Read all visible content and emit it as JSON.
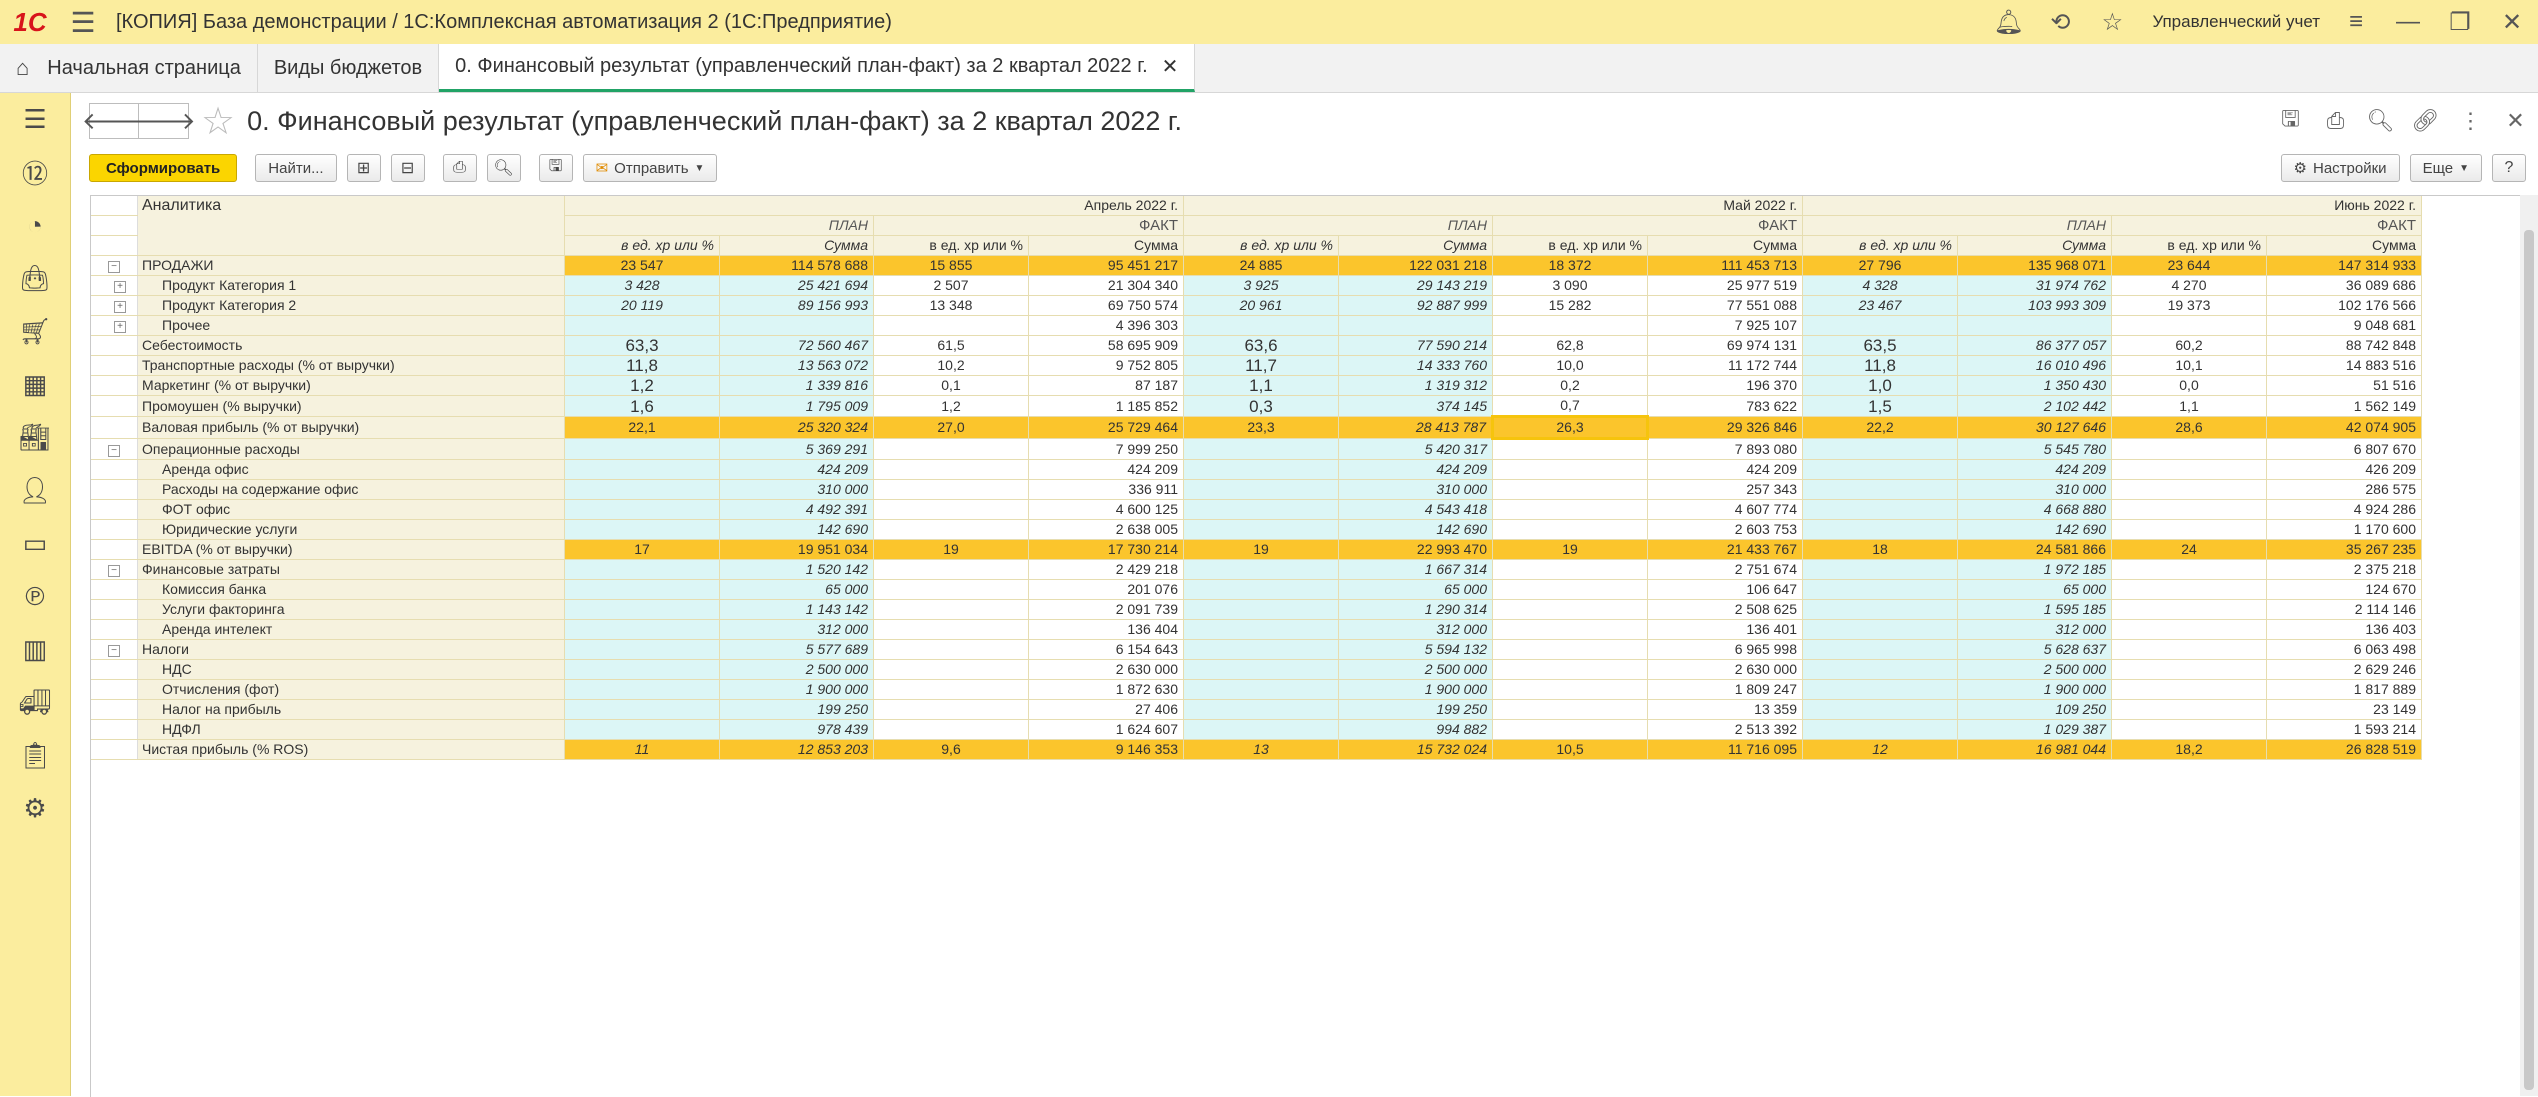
{
  "app": {
    "logo": "1С",
    "title": "[КОПИЯ] База демонстрации / 1С:Комплексная автоматизация 2  (1С:Предприятие)",
    "user": "Управленческий учет"
  },
  "tabs": [
    {
      "label": "Начальная страница"
    },
    {
      "label": "Виды  бюджетов"
    },
    {
      "label": "0. Финансовый результат (управленческий план-факт)  за 2 квартал 2022 г."
    }
  ],
  "form": {
    "title": "0. Финансовый результат (управленческий план-факт)  за 2 квартал 2022 г."
  },
  "toolbar": {
    "generate": "Сформировать",
    "find": "Найти...",
    "send": "Отправить",
    "settings": "Настройки",
    "more": "Еще",
    "help": "?"
  },
  "report": {
    "header_label": "Аналитика",
    "months": [
      "Апрель 2022 г.",
      "Май 2022 г.",
      "Июнь 2022 г."
    ],
    "plan": "ПЛАН",
    "fact": "ФАКТ",
    "col_unit": "в ед. хр или %",
    "col_sum": "Сумма",
    "rows": [
      {
        "label": "ПРОДАЖИ",
        "type": "big",
        "tree": "minus",
        "values": [
          "23 547",
          "114 578 688",
          "15 855",
          "95 451 217",
          "24 885",
          "122 031 218",
          "18 372",
          "111 453 713",
          "27 796",
          "135 968 071",
          "23 644",
          "147 314 933"
        ]
      },
      {
        "label": "Продукт Категория 1",
        "type": "sub",
        "tree": "plus",
        "values": [
          "3 428",
          "25 421 694",
          "2 507",
          "21 304 340",
          "3 925",
          "29 143 219",
          "3 090",
          "25 977 519",
          "4 328",
          "31 974 762",
          "4 270",
          "36 089 686"
        ]
      },
      {
        "label": "Продукт Категория 2",
        "type": "sub",
        "tree": "plus",
        "values": [
          "20 119",
          "89 156 993",
          "13 348",
          "69 750 574",
          "20 961",
          "92 887 999",
          "15 282",
          "77 551 088",
          "23 467",
          "103 993 309",
          "19 373",
          "102 176 566"
        ]
      },
      {
        "label": "Прочее",
        "type": "sub",
        "tree": "plus",
        "values": [
          "",
          "",
          "",
          "4 396 303",
          "",
          "",
          "",
          "7 925 107",
          "",
          "",
          "",
          "9 048 681"
        ]
      },
      {
        "label": "Себестоимость",
        "type": "mid",
        "tree": "",
        "values": [
          "63,3",
          "72 560 467",
          "61,5",
          "58 695 909",
          "63,6",
          "77 590 214",
          "62,8",
          "69 974 131",
          "63,5",
          "86 377 057",
          "60,2",
          "88 742 848"
        ]
      },
      {
        "label": "Транспортные расходы  (% от выручки)",
        "type": "mid",
        "tree": "",
        "values": [
          "11,8",
          "13 563 072",
          "10,2",
          "9 752 805",
          "11,7",
          "14 333 760",
          "10,0",
          "11 172 744",
          "11,8",
          "16 010 496",
          "10,1",
          "14 883 516"
        ]
      },
      {
        "label": "Маркетинг (% от выручки)",
        "type": "mid",
        "tree": "",
        "values": [
          "1,2",
          "1 339 816",
          "0,1",
          "87 187",
          "1,1",
          "1 319 312",
          "0,2",
          "196 370",
          "1,0",
          "1 350 430",
          "0,0",
          "51 516"
        ]
      },
      {
        "label": "Промоушен (% выручки)",
        "type": "mid",
        "tree": "",
        "values": [
          "1,6",
          "1 795 009",
          "1,2",
          "1 185 852",
          "0,3",
          "374 145",
          "0,7",
          "783 622",
          "1,5",
          "2 102 442",
          "1,1",
          "1 562 149"
        ]
      },
      {
        "label": "Валовая прибыль (% от выручки)",
        "type": "big",
        "tree": "",
        "values": [
          "22,1",
          "25 320 324",
          "27,0",
          "25 729 464",
          "23,3",
          "28 413 787",
          "26,3",
          "29 326 846",
          "22,2",
          "30 127 646",
          "28,6",
          "42 074 905"
        ]
      },
      {
        "label": "Операционные расходы",
        "type": "grp",
        "tree": "minus",
        "values": [
          "",
          "5 369 291",
          "",
          "7 999 250",
          "",
          "5 420 317",
          "",
          "7 893 080",
          "",
          "5 545 780",
          "",
          "6 807 670"
        ]
      },
      {
        "label": "Аренда офис",
        "type": "sub2",
        "tree": "",
        "values": [
          "",
          "424 209",
          "",
          "424 209",
          "",
          "424 209",
          "",
          "424 209",
          "",
          "424 209",
          "",
          "426 209"
        ]
      },
      {
        "label": "Расходы на содержание офис",
        "type": "sub2",
        "tree": "",
        "values": [
          "",
          "310 000",
          "",
          "336 911",
          "",
          "310 000",
          "",
          "257 343",
          "",
          "310 000",
          "",
          "286 575"
        ]
      },
      {
        "label": "ФОТ офис",
        "type": "sub2",
        "tree": "",
        "values": [
          "",
          "4 492 391",
          "",
          "4 600 125",
          "",
          "4 543 418",
          "",
          "4 607 774",
          "",
          "4 668 880",
          "",
          "4 924 286"
        ]
      },
      {
        "label": "Юридические услуги",
        "type": "sub2",
        "tree": "",
        "values": [
          "",
          "142 690",
          "",
          "2 638 005",
          "",
          "142 690",
          "",
          "2 603 753",
          "",
          "142 690",
          "",
          "1 170 600"
        ]
      },
      {
        "label": "EBITDA (% от выручки)",
        "type": "big",
        "tree": "",
        "values": [
          "17",
          "19 951 034",
          "19",
          "17 730 214",
          "19",
          "22 993 470",
          "19",
          "21 433 767",
          "18",
          "24 581 866",
          "24",
          "35 267 235"
        ]
      },
      {
        "label": "Финансовые затраты",
        "type": "grp",
        "tree": "minus",
        "values": [
          "",
          "1 520 142",
          "",
          "2 429 218",
          "",
          "1 667 314",
          "",
          "2 751 674",
          "",
          "1 972 185",
          "",
          "2 375 218"
        ]
      },
      {
        "label": "Комиссия банка",
        "type": "sub2",
        "tree": "",
        "values": [
          "",
          "65 000",
          "",
          "201 076",
          "",
          "65 000",
          "",
          "106 647",
          "",
          "65 000",
          "",
          "124 670"
        ]
      },
      {
        "label": "Услуги факторинга",
        "type": "sub2",
        "tree": "",
        "values": [
          "",
          "1 143 142",
          "",
          "2 091 739",
          "",
          "1 290 314",
          "",
          "2 508 625",
          "",
          "1 595 185",
          "",
          "2 114 146"
        ]
      },
      {
        "label": "Аренда интелект",
        "type": "sub2",
        "tree": "",
        "values": [
          "",
          "312 000",
          "",
          "136 404",
          "",
          "312 000",
          "",
          "136 401",
          "",
          "312 000",
          "",
          "136 403"
        ]
      },
      {
        "label": "Налоги",
        "type": "grp",
        "tree": "minus",
        "values": [
          "",
          "5 577 689",
          "",
          "6 154 643",
          "",
          "5 594 132",
          "",
          "6 965 998",
          "",
          "5 628 637",
          "",
          "6 063 498"
        ]
      },
      {
        "label": "НДС",
        "type": "sub2",
        "tree": "",
        "values": [
          "",
          "2 500 000",
          "",
          "2 630 000",
          "",
          "2 500 000",
          "",
          "2 630 000",
          "",
          "2 500 000",
          "",
          "2 629 246"
        ]
      },
      {
        "label": "Отчисления (фот)",
        "type": "sub2",
        "tree": "",
        "values": [
          "",
          "1 900 000",
          "",
          "1 872 630",
          "",
          "1 900 000",
          "",
          "1 809 247",
          "",
          "1 900 000",
          "",
          "1 817 889"
        ]
      },
      {
        "label": "Налог на прибыль",
        "type": "sub2",
        "tree": "",
        "values": [
          "",
          "199 250",
          "",
          "27 406",
          "",
          "199 250",
          "",
          "13 359",
          "",
          "109 250",
          "",
          "23 149"
        ]
      },
      {
        "label": "НДФЛ",
        "type": "sub2",
        "tree": "",
        "values": [
          "",
          "978 439",
          "",
          "1 624 607",
          "",
          "994 882",
          "",
          "2 513 392",
          "",
          "1 029 387",
          "",
          "1 593 214"
        ]
      },
      {
        "label": "Чистая прибыль (% ROS)",
        "type": "bigit",
        "tree": "",
        "values": [
          "11",
          "12 853 203",
          "9,6",
          "9 146 353",
          "13",
          "15 732 024",
          "10,5",
          "11 716 095",
          "12",
          "16 981 044",
          "18,2",
          "26 828 519"
        ]
      }
    ]
  }
}
